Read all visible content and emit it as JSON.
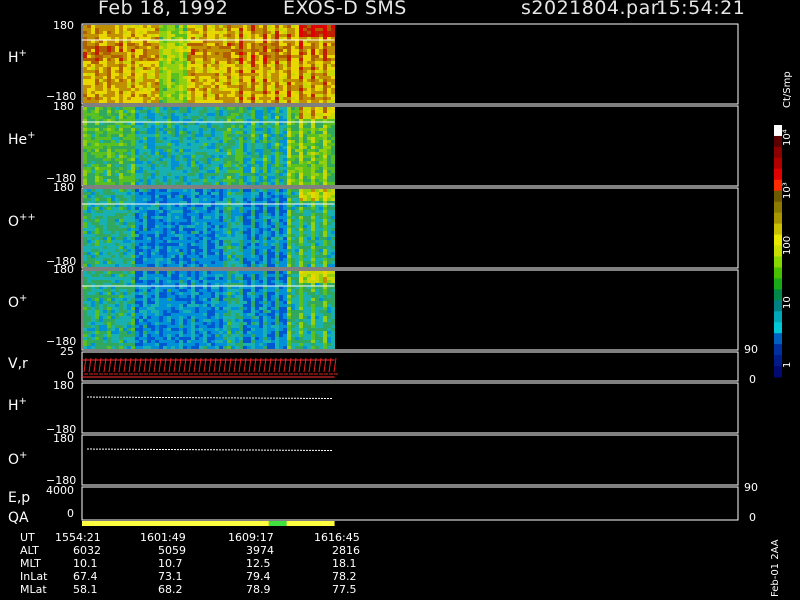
{
  "header": {
    "date": "Feb 18, 1992",
    "title": "EXOS-D SMS",
    "file": "s2021804.par",
    "time": "15:54:21"
  },
  "panels": [
    {
      "id": "hplus",
      "label": "H",
      "sup": "+",
      "top_tick": "180",
      "bottom_tick": "−180"
    },
    {
      "id": "heplus",
      "label": "He",
      "sup": "+",
      "top_tick": "180",
      "bottom_tick": "−180"
    },
    {
      "id": "opp",
      "label": "O",
      "sup": "++",
      "top_tick": "180",
      "bottom_tick": "−180"
    },
    {
      "id": "oplus",
      "label": "O",
      "sup": "+",
      "top_tick": "180",
      "bottom_tick": "−180"
    }
  ],
  "vr_panel": {
    "label": "V,r",
    "left_top": "25",
    "left_bottom": "0",
    "right_top": "90",
    "right_bottom": "0"
  },
  "angle_panels": [
    {
      "id": "h",
      "label": "H",
      "sup": "+",
      "top_tick": "180",
      "bottom_tick": "−180"
    },
    {
      "id": "o",
      "label": "O",
      "sup": "+",
      "top_tick": "180",
      "bottom_tick": "−180"
    }
  ],
  "ep_panel": {
    "label": "E,p",
    "left_top": "4000",
    "left_bottom": "0",
    "right_top": "90",
    "right_bottom": "0"
  },
  "qa_label": "QA",
  "colorbar": {
    "unit": "Ct/Smp",
    "ticks": [
      "10⁴",
      "10³",
      "100",
      "10",
      "1"
    ],
    "colors": [
      "#ffffff",
      "#5a0000",
      "#8b0000",
      "#b00000",
      "#e00000",
      "#ff2a00",
      "#6b5a00",
      "#8b7a00",
      "#a89500",
      "#c8c000",
      "#e8e800",
      "#c8e000",
      "#88d800",
      "#48c000",
      "#18a818",
      "#00884a",
      "#008080",
      "#00a8b8",
      "#00c8d8",
      "#0060c0",
      "#0030a0",
      "#001a88",
      "#000a70"
    ]
  },
  "footer_table": {
    "rows": [
      {
        "name": "UT",
        "values": [
          "1554:21",
          "1601:49",
          "1609:17",
          "1616:45"
        ]
      },
      {
        "name": "ALT",
        "values": [
          "6032",
          "5059",
          "3974",
          "2816"
        ]
      },
      {
        "name": "MLT",
        "values": [
          "10.1",
          "10.7",
          "12.5",
          "18.1"
        ]
      },
      {
        "name": "InLat",
        "values": [
          "67.4",
          "73.1",
          "79.4",
          "78.2"
        ]
      },
      {
        "name": "MLat",
        "values": [
          "58.1",
          "68.2",
          "78.9",
          "77.5"
        ]
      }
    ]
  },
  "side_note": "Feb-01 2AA",
  "chart_data": {
    "type": "heatmap",
    "title": "EXOS-D SMS",
    "x_ticks": [
      "1554:21",
      "1601:49",
      "1609:17",
      "1616:45"
    ],
    "y_range": [
      -180,
      180
    ],
    "color_scale": {
      "type": "log",
      "range": [
        1,
        10000
      ],
      "unit": "Ct/Smp"
    },
    "data_coverage_fraction": 0.385,
    "series": [
      {
        "name": "H+",
        "mean_level": 120
      },
      {
        "name": "He+",
        "mean_level": 4
      },
      {
        "name": "O++",
        "mean_level": 2
      },
      {
        "name": "O+",
        "mean_level": 2
      }
    ],
    "vr": {
      "range_left": [
        0,
        25
      ],
      "range_right": [
        0,
        90
      ]
    },
    "ep": {
      "range_left": [
        0,
        4000
      ],
      "range_right": [
        0,
        90
      ]
    },
    "qa_segments": [
      {
        "from": 0.0,
        "to": 0.74,
        "color": "#ffff40"
      },
      {
        "from": 0.74,
        "to": 0.81,
        "color": "#40e040"
      },
      {
        "from": 0.81,
        "to": 1.0,
        "color": "#ffff40"
      }
    ]
  }
}
